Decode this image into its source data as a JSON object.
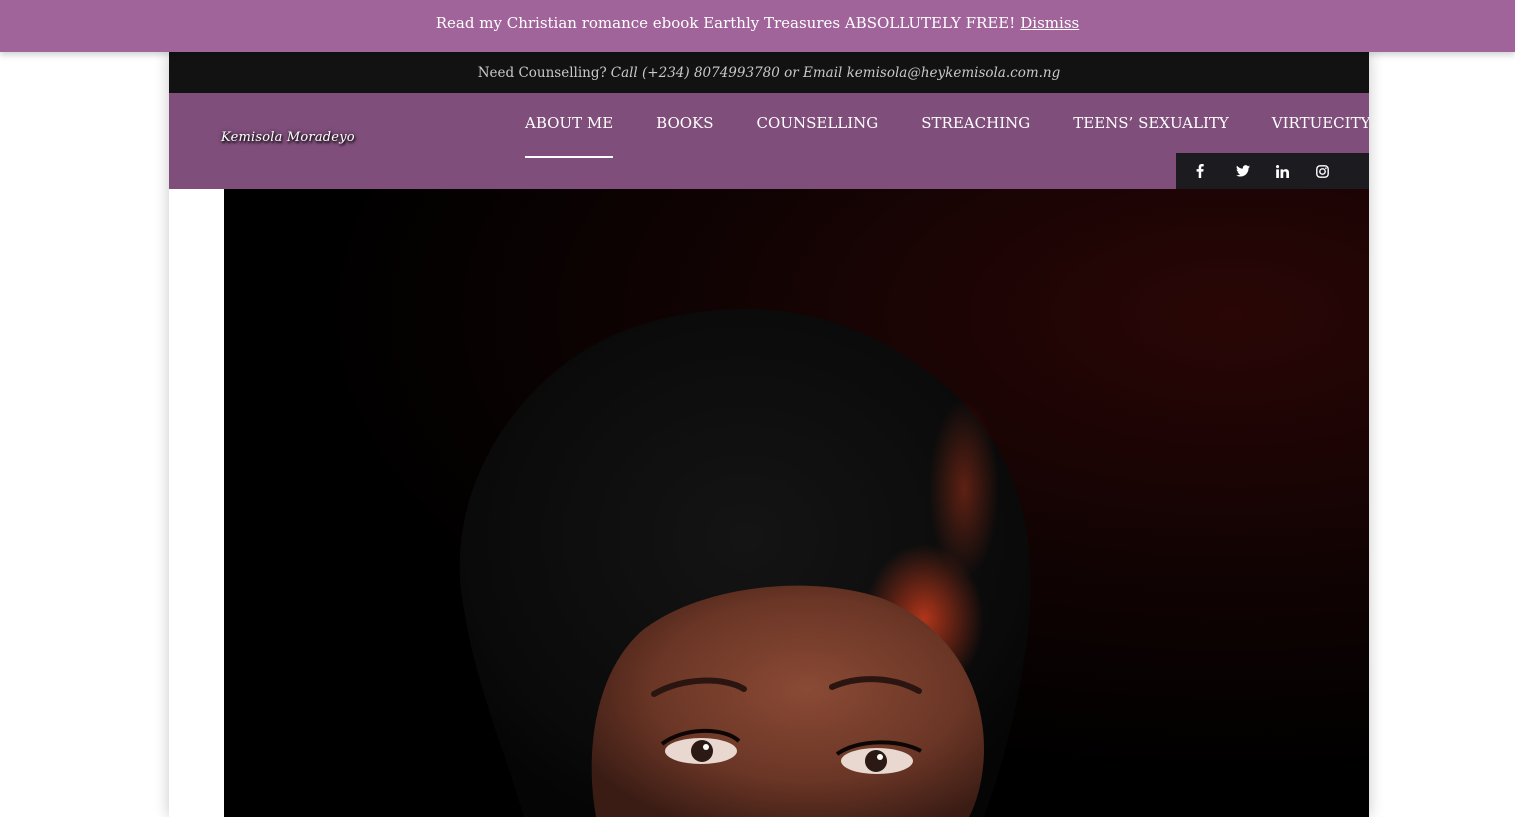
{
  "notice": {
    "text": "Read my Christian romance ebook Earthly Treasures ABSOLLUTELY FREE!",
    "dismiss_label": "Dismiss"
  },
  "topbar": {
    "prefix": "Need Counselling?",
    "contact": "Call (+234) 8074993780 or Email kemisola@heykemisola.com.ng"
  },
  "logo": {
    "text": "Kemisola Moradeyo"
  },
  "nav": {
    "items": [
      {
        "label": "ABOUT ME",
        "active": true
      },
      {
        "label": "BOOKS"
      },
      {
        "label": "COUNSELLING"
      },
      {
        "label": "STREACHING"
      },
      {
        "label": "TEENS’ SEXUALITY"
      },
      {
        "label": "VIRTUECITY",
        "dropdown": true
      }
    ]
  },
  "social": {
    "icons": [
      "facebook-icon",
      "twitter-icon",
      "linkedin-icon",
      "instagram-icon"
    ]
  },
  "hero": {
    "image_name": "portrait-photo"
  },
  "colors": {
    "notice_bg": "#a1649a",
    "topbar_bg": "#121212",
    "header_bg": "#7f4e7b",
    "social_bg": "#1c1b20"
  }
}
